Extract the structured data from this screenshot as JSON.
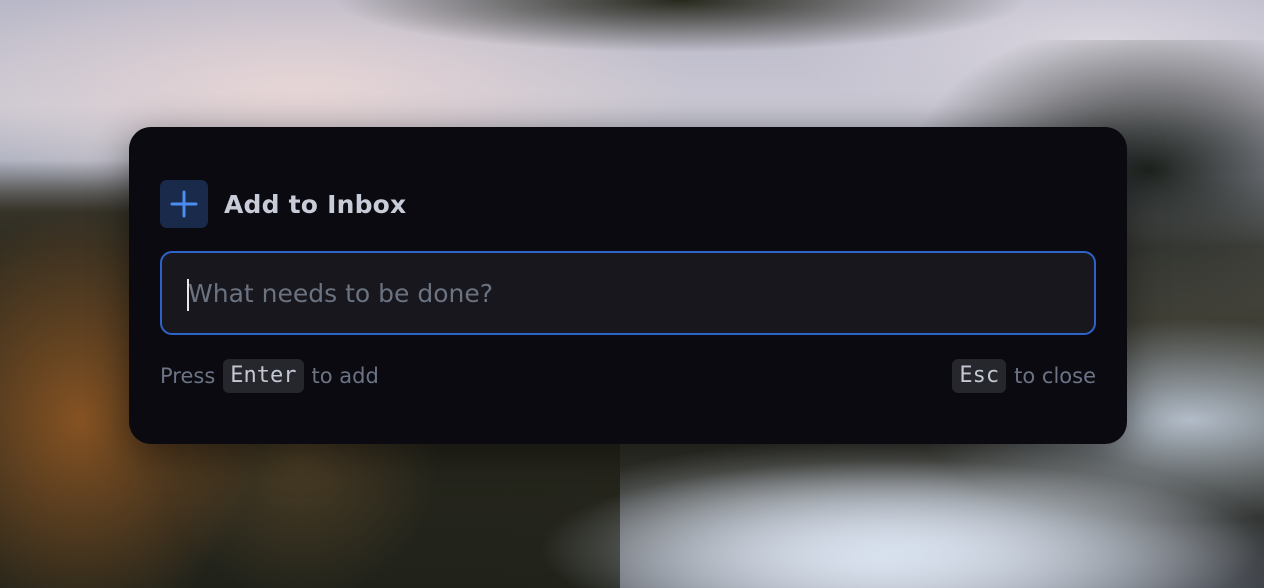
{
  "dialog": {
    "title": "Add to Inbox",
    "icon": "plus-icon",
    "input": {
      "value": "",
      "placeholder": "What needs to be done?"
    },
    "hints": {
      "add_prefix": "Press",
      "add_key": "Enter",
      "add_suffix": "to add",
      "close_key": "Esc",
      "close_suffix": "to close"
    }
  },
  "colors": {
    "dialog_background": "#0a0a10",
    "accent": "#2e63c9",
    "icon_accent": "#4a8cf0"
  }
}
